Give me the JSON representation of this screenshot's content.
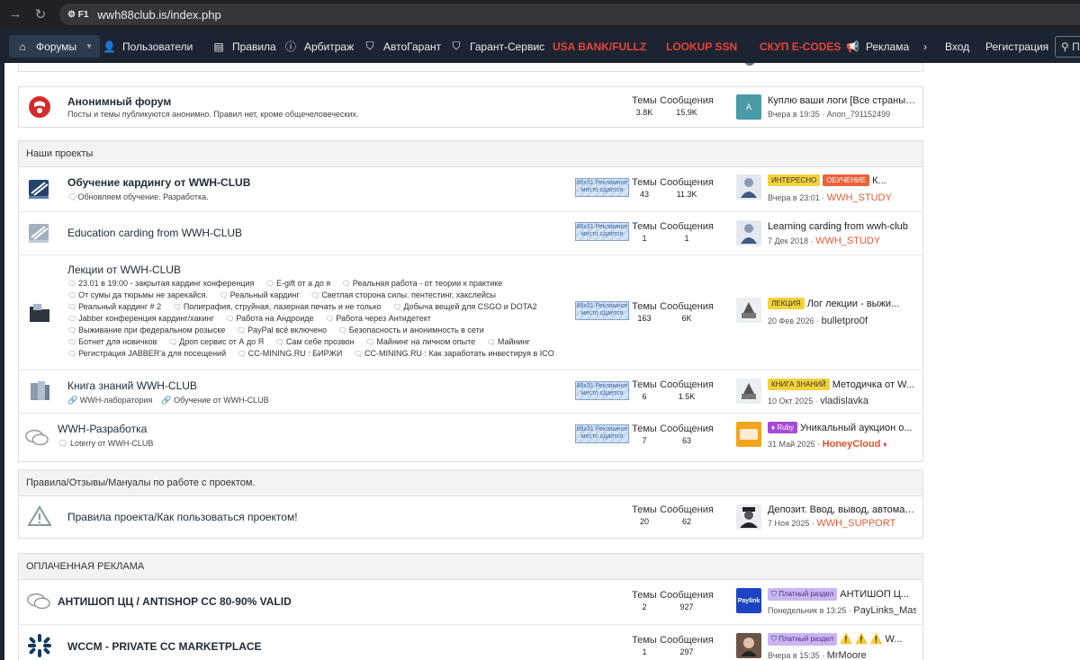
{
  "browser": {
    "url": "wwh88club.is/index.php",
    "site_label": "F1"
  },
  "nav": {
    "items": [
      {
        "label": "Форумы"
      },
      {
        "label": "Пользователи"
      },
      {
        "label": "Правила"
      },
      {
        "label": "Арбитраж"
      },
      {
        "label": "АвтоГарант"
      },
      {
        "label": "Гарант-Сервис"
      },
      {
        "label": "USA BANK/FULLZ"
      },
      {
        "label": "LOOKUP SSN"
      },
      {
        "label": "СКУП E-CODES"
      },
      {
        "label": "Реклама"
      }
    ],
    "login": "Вход",
    "register": "Регистрация",
    "search_placeholder": "П"
  },
  "anon": {
    "title": "Анонимный форум",
    "desc": "Посты и темы публикуются анонимно. Правил нет, кроме общечеловеческих.",
    "threads_label": "Темы",
    "threads": "3.8K",
    "messages_label": "Сообщения",
    "messages": "15.9K",
    "avatar_letter": "A",
    "last_title": "Куплю ваши логи [Все страны] ...",
    "last_date": "Вчера в 19:35",
    "last_user": "Anon_791152499"
  },
  "projects": {
    "header": "Наши проекты",
    "ad_text": "88x31 Рекламное место сдается",
    "threads_label": "Темы",
    "messages_label": "Сообщения",
    "forums": [
      {
        "title": "Обучение кардингу от WWH-CLUB",
        "sub": "Обновляем обучение. Разработка.",
        "threads": "43",
        "messages": "11.3K",
        "badge1": "ИНТЕРЕСНО",
        "badge2": "ОБУЧЕНИЕ",
        "last_title": "К...",
        "last_date": "Вчера в 23:01",
        "last_user": "WWH_STUDY"
      },
      {
        "title": "Education carding from WWH-CLUB",
        "threads": "1",
        "messages": "1",
        "last_title": "Learning carding from wwh-club",
        "last_date": "7 Дек 2018",
        "last_user": "WWH_STUDY"
      },
      {
        "title": "Лекции от WWH-CLUB",
        "threads": "163",
        "messages": "6K",
        "badge": "ЛЕКЦИЯ",
        "last_title": "Лог лекции - выжи...",
        "last_date": "20 Фев 2026",
        "last_user": "bulletpro0f",
        "sublinks": [
          "23.01 в 19:00 - закрытая кардинг конференция",
          "E-gift от а до я",
          "Реальная работа - от теории к практике",
          "От сумы да тюрьмы не зарекайся.",
          "Реальный кардинг",
          "Светлая сторона силы. пентестинг, хакслейсы",
          "Реальный кардинг # 2",
          "Полиграфия, струйная, лазерная печать и не только",
          "Добыча вещей для CSGO и DOTA2",
          "Jabber конференция кардинг/хакинг",
          "Работа на Андроиде",
          "Работа через Антидетект",
          "Выживание при федеральном розыске",
          "PayPal всё включено",
          "Безопасность и анонимность в сети",
          "Ботнет для новичков",
          "Дроп сервис от А до Я",
          "Сам себе прозвон",
          "Майнинг на личном опыте",
          "Майнинг",
          "Регистрация JABBER'a для посещений",
          "CC-MINING.RU : БИРЖИ",
          "CC-MINING.RU : Как заработать инвестируя в ICO"
        ]
      },
      {
        "title": "Книга знаний WWH-CLUB",
        "sub1": "WWH-лаборатория",
        "sub2": "Обучение от WWH-CLUB",
        "threads": "6",
        "messages": "1.5K",
        "badge": "КНИГА ЗНАНИЙ",
        "last_title": "Методичка от W...",
        "last_date": "10 Окт 2025",
        "last_user": "vladislavka"
      },
      {
        "title": "WWH-Разработка",
        "sub": "Loterry от WWH-CLUB",
        "threads": "7",
        "messages": "63",
        "badge": "Ruby",
        "last_title": "Уникальный аукцион о...",
        "last_date": "31 Май 2025",
        "last_user": "HoneyCloud"
      }
    ]
  },
  "rules": {
    "header": "Правила/Отзывы/Мануалы по работе с проектом.",
    "title": "Правила проекта/Как пользоваться проектом!",
    "threads_label": "Темы",
    "threads": "20",
    "messages_label": "Сообщения",
    "messages": "62",
    "last_title": "Депозит. Ввод, вывод, автомат...",
    "last_date": "7 Ноя 2025",
    "last_user": "WWH_SUPPORT"
  },
  "paid": {
    "header": "ОПЛАЧЕННАЯ РЕКЛАМА",
    "threads_label": "Темы",
    "messages_label": "Сообщения",
    "forums": [
      {
        "title": "АНТИШОП ЦЦ / ANTISHOP CC 80-90% VALID",
        "threads": "2",
        "messages": "927",
        "avatar_text": "Paylink",
        "badge": "Платный раздел",
        "last_title": "АНТИШОП Ц...",
        "last_date": "Понедельник в 13:25",
        "last_user": "PayLinks_Master"
      },
      {
        "title": "WCCM - PRIVATE CC MARKETPLACE",
        "threads": "1",
        "messages": "297",
        "badge": "Платный раздел",
        "last_title": "⚠️ ⚠️ ⚠️ W...",
        "last_date": "Вчера в 15:35",
        "last_user": "MrMoore"
      }
    ]
  },
  "colors": {
    "nav_bg": "#1b2430",
    "accent_red": "#e8423a",
    "user_orange": "#e25d33"
  }
}
